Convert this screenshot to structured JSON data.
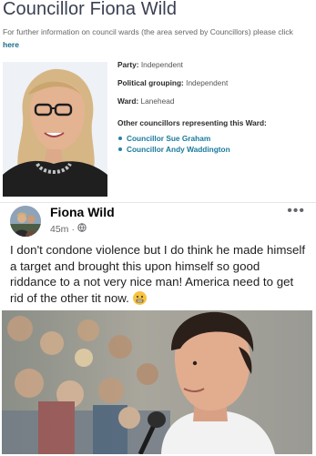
{
  "council": {
    "title": "Councillor Fiona Wild",
    "info_text": "For further information on council wards (the area served by Councillors) please click",
    "info_link": "here",
    "party_label": "Party:",
    "party_value": "Independent",
    "grouping_label": "Political grouping:",
    "grouping_value": "Independent",
    "ward_label": "Ward:",
    "ward_value": "Lanehead",
    "other_heading": "Other councillors representing this Ward:",
    "other_councillors": [
      "Councillor Sue Graham",
      "Councillor Andy Waddington"
    ]
  },
  "post": {
    "author": "Fiona Wild",
    "time": "45m",
    "separator": "·",
    "privacy_icon": "globe-icon",
    "menu_icon": "more-options-icon",
    "menu_label": "•••",
    "text": "I don't condone violence but I do think he made himself a target and brought this upon himself so good riddance to a not very nice man! America need to get rid of the other tit now.",
    "emoji_icon": "grimace-emoji-icon"
  },
  "colors": {
    "title": "#3a3f52",
    "link": "#1a7a9c",
    "fb_text": "#1c1e21",
    "fb_meta": "#65676b"
  }
}
